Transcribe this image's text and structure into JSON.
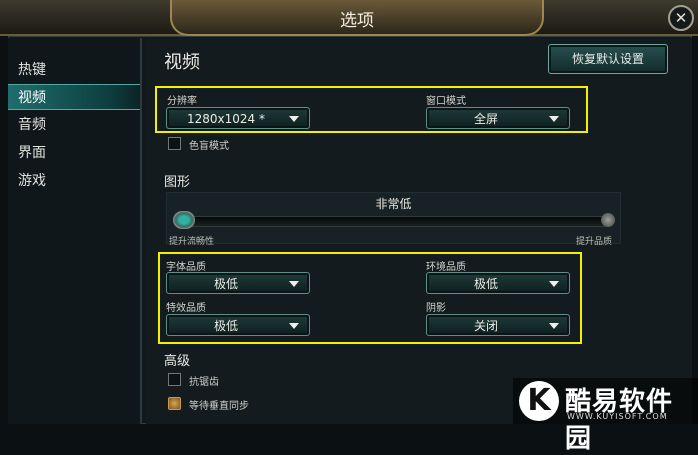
{
  "window": {
    "title": "选项",
    "close_symbol": "✕"
  },
  "sidebar": {
    "items": [
      {
        "label": "热键",
        "active": false
      },
      {
        "label": "视频",
        "active": true
      },
      {
        "label": "音频",
        "active": false
      },
      {
        "label": "界面",
        "active": false
      },
      {
        "label": "游戏",
        "active": false
      }
    ]
  },
  "video": {
    "title": "视频",
    "restore_defaults_label": "恢复默认设置",
    "resolution": {
      "label": "分辨率",
      "value": "1280x1024 *"
    },
    "window_mode": {
      "label": "窗口模式",
      "value": "全屏"
    },
    "colorblind": {
      "label": "色盲模式",
      "checked": false
    }
  },
  "graphics": {
    "title": "图形",
    "quality_value": "非常低",
    "slider_level": 0,
    "slider_left_label": "提升流畅性",
    "slider_right_label": "提升品质",
    "character_quality": {
      "label": "字体品质",
      "value": "极低"
    },
    "environment_quality": {
      "label": "环境品质",
      "value": "极低"
    },
    "effects_quality": {
      "label": "特效品质",
      "value": "极低"
    },
    "shadows": {
      "label": "阴影",
      "value": "关闭"
    }
  },
  "advanced": {
    "title": "高级",
    "antialiasing": {
      "label": "抗锯齿",
      "checked": false
    },
    "vsync": {
      "label": "等待垂直同步",
      "checked": true
    }
  },
  "watermark": {
    "logo_letter": "K",
    "name": "酷易软件园",
    "url": "WWW.KUYISOFT.COM"
  },
  "colors": {
    "accent": "#1f6e6c",
    "highlight": "#f4f000",
    "background": "#141b1e"
  }
}
